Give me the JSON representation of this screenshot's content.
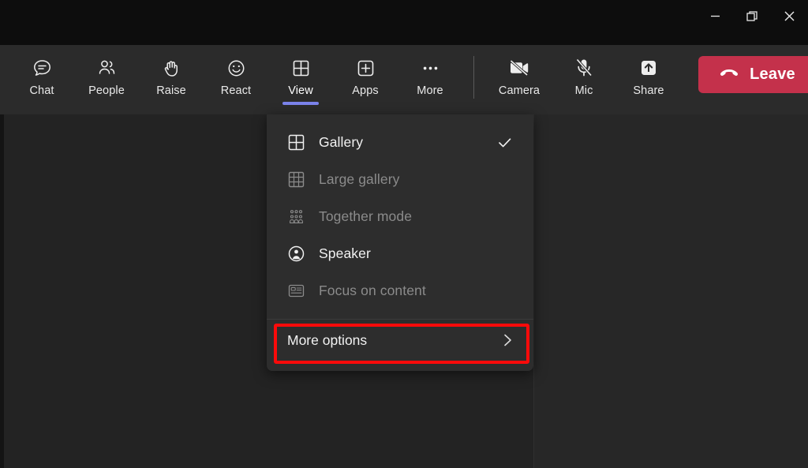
{
  "window": {
    "controls": [
      {
        "name": "minimize",
        "label": "Minimize",
        "icon": "minimize-icon"
      },
      {
        "name": "restore",
        "label": "Restore",
        "icon": "restore-icon"
      },
      {
        "name": "close",
        "label": "Close",
        "icon": "close-icon"
      }
    ]
  },
  "toolbar": {
    "items": [
      {
        "label": "Chat",
        "icon": "chat-icon",
        "active": false
      },
      {
        "label": "People",
        "icon": "people-icon",
        "active": false
      },
      {
        "label": "Raise",
        "icon": "raise-hand-icon",
        "active": false
      },
      {
        "label": "React",
        "icon": "react-smiley-icon",
        "active": false
      },
      {
        "label": "View",
        "icon": "view-grid-icon",
        "active": true
      },
      {
        "label": "Apps",
        "icon": "apps-plus-icon",
        "active": false
      },
      {
        "label": "More",
        "icon": "more-ellipsis-icon",
        "active": false
      }
    ],
    "device_items": [
      {
        "label": "Camera",
        "icon": "camera-off-icon",
        "muted": true
      },
      {
        "label": "Mic",
        "icon": "mic-off-icon",
        "muted": true
      },
      {
        "label": "Share",
        "icon": "share-up-arrow-icon",
        "muted": false
      }
    ],
    "leave": {
      "label": "Leave",
      "icon": "hangup-phone-icon",
      "color": "#c4314b"
    },
    "active_indicator_color": "#7b83eb"
  },
  "view_menu": {
    "items": [
      {
        "label": "Gallery",
        "icon": "grid-2x2-icon",
        "enabled": true,
        "checked": true
      },
      {
        "label": "Large gallery",
        "icon": "grid-3x3-icon",
        "enabled": false,
        "checked": false
      },
      {
        "label": "Together mode",
        "icon": "together-mode-icon",
        "enabled": false,
        "checked": false
      },
      {
        "label": "Speaker",
        "icon": "speaker-person-icon",
        "enabled": true,
        "checked": false
      },
      {
        "label": "Focus on content",
        "icon": "focus-content-icon",
        "enabled": false,
        "checked": false
      }
    ],
    "more_options": {
      "label": "More options",
      "icon": "chevron-right-icon"
    },
    "check_icon": "checkmark-icon"
  },
  "annotation": {
    "target": "More options",
    "color": "#fb0a0a"
  }
}
